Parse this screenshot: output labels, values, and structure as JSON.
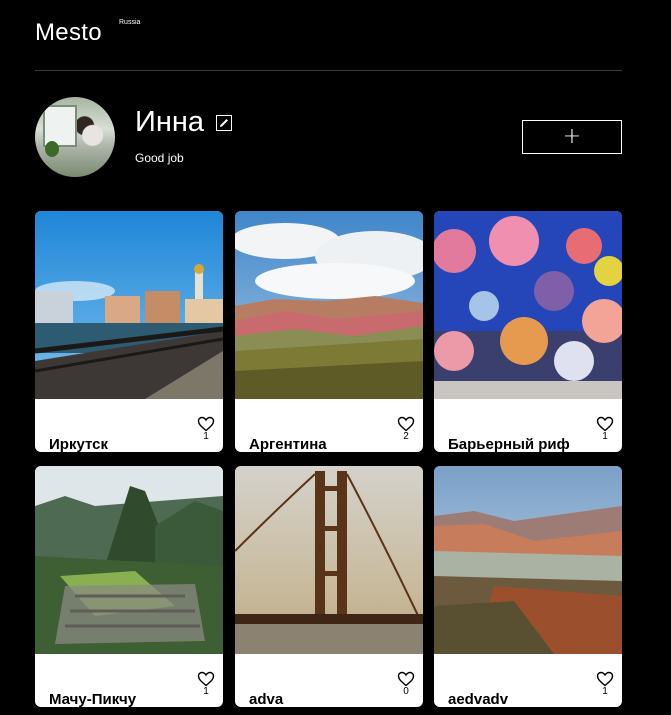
{
  "header": {
    "logo": "Mesto",
    "logo_sup": "Russia"
  },
  "profile": {
    "name": "Инна",
    "about": "Good job",
    "avatar_icon": "user-photo",
    "edit_icon": "pencil-icon",
    "add_label": "+"
  },
  "cards": [
    {
      "title": "Иркутск",
      "likes": "1"
    },
    {
      "title": "Аргентина",
      "likes": "2"
    },
    {
      "title": "Барьерный риф",
      "likes": "1"
    },
    {
      "title": "Мачу-Пикчу",
      "likes": "1"
    },
    {
      "title": "adva",
      "likes": "0"
    },
    {
      "title": "aedvadv",
      "likes": "1"
    }
  ],
  "colors": {
    "background": "#000000",
    "card": "#ffffff",
    "divider": "#545454"
  }
}
